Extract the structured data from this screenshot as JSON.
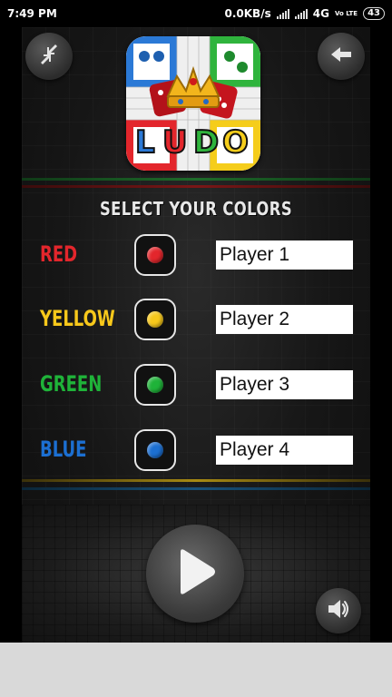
{
  "status_bar": {
    "time": "7:49 PM",
    "network_speed": "0.0KB/s",
    "network_type": "4G",
    "volte": "Vo LTE",
    "battery": "43"
  },
  "header": {
    "logo_text": "LUDO",
    "left_icon": "collapse-arrows-icon",
    "right_icon": "back-arrow-icon"
  },
  "section_title": "SELECT YOUR COLORS",
  "players": [
    {
      "color_label": "RED",
      "color": "#e3262c",
      "player_name": "Player 1"
    },
    {
      "color_label": "YELLOW",
      "color": "#f7c81b",
      "player_name": "Player 2"
    },
    {
      "color_label": "GREEN",
      "color": "#1fb339",
      "player_name": "Player 3"
    },
    {
      "color_label": "BLUE",
      "color": "#1c6fd1",
      "player_name": "Player 4"
    }
  ],
  "controls": {
    "play_icon": "play-icon",
    "sound_icon": "speaker-icon"
  },
  "colors": {
    "panel_bg": "#161616",
    "divider_green": "#1d6b2a",
    "divider_red": "#7a1616",
    "divider_yellow": "#a88a13",
    "divider_blue": "#17507a"
  }
}
